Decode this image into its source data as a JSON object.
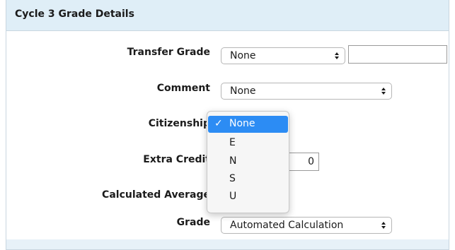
{
  "panel": {
    "title": "Cycle 3 Grade Details"
  },
  "fields": {
    "transfer_grade": {
      "label": "Transfer Grade",
      "value": "None",
      "text_value": ""
    },
    "comment": {
      "label": "Comment",
      "value": "None"
    },
    "citizenship": {
      "label": "Citizenship",
      "options": [
        "None",
        "E",
        "N",
        "S",
        "U"
      ],
      "selected": "None",
      "check_mark": "✓"
    },
    "extra_credit": {
      "label": "Extra Credit",
      "value": "0"
    },
    "calculated_average": {
      "label": "Calculated Average"
    },
    "grade": {
      "label": "Grade",
      "value": "Automated Calculation"
    }
  },
  "colors": {
    "header_bg": "#dfeef7",
    "selection_blue": "#2c8cf4",
    "border": "#c9d6e0"
  },
  "icons": {
    "select_arrows": "up-down-arrows-icon"
  }
}
